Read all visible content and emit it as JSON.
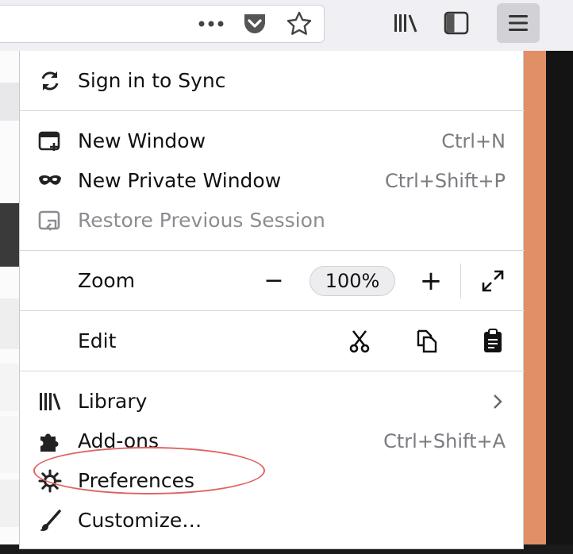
{
  "menu": {
    "sign_in": "Sign in to Sync",
    "new_window": {
      "label": "New Window",
      "shortcut": "Ctrl+N"
    },
    "new_private": {
      "label": "New Private Window",
      "shortcut": "Ctrl+Shift+P"
    },
    "restore": "Restore Previous Session",
    "zoom": {
      "label": "Zoom",
      "minus": "−",
      "level": "100%",
      "plus": "+"
    },
    "edit": {
      "label": "Edit"
    },
    "library": "Library",
    "addons": {
      "label": "Add-ons",
      "shortcut": "Ctrl+Shift+A"
    },
    "preferences": "Preferences",
    "customize": "Customize…"
  },
  "icons": {
    "toolbar": [
      "more-icon",
      "pocket-icon",
      "star-icon",
      "library-icon",
      "sidebar-icon",
      "hamburger-icon"
    ],
    "menu": [
      "sync-icon",
      "new-window-icon",
      "private-mask-icon",
      "restore-icon",
      "cut-icon",
      "copy-icon",
      "paste-icon",
      "library-icon",
      "puzzle-icon",
      "gear-icon",
      "brush-icon"
    ]
  },
  "colors": {
    "annotation": "#e06262",
    "page_accent": "#e08f66"
  }
}
